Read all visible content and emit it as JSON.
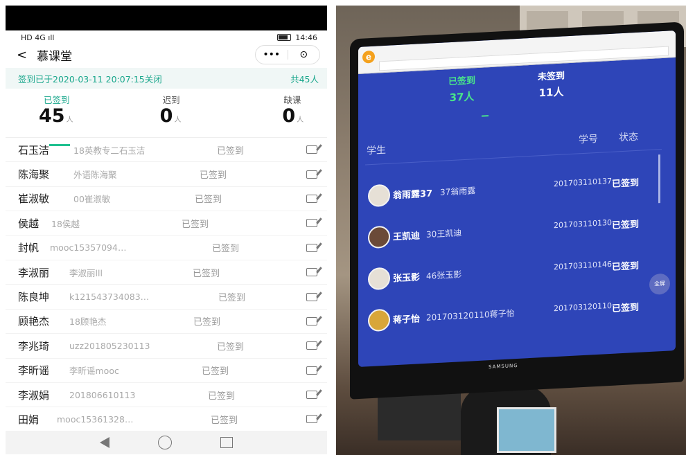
{
  "phone": {
    "status_bar": {
      "signal": "HD 4G ıll",
      "time": "14:46"
    },
    "nav": {
      "back_icon": "back-chevron-icon",
      "title": "慕课堂",
      "more_label": "•••",
      "close_icon": "record-circle-icon"
    },
    "notice": {
      "text": "签到已于2020-03-11 20:07:15关闭",
      "total": "共45人"
    },
    "stats": [
      {
        "label": "已签到",
        "value": "45",
        "unit": "人"
      },
      {
        "label": "迟到",
        "value": "0",
        "unit": "人"
      },
      {
        "label": "缺课",
        "value": "0",
        "unit": "人"
      }
    ],
    "students": [
      {
        "name": "石玉洁",
        "sub": "18英教专二石玉洁",
        "status": "已签到"
      },
      {
        "name": "陈海聚",
        "sub": "外语陈海聚",
        "status": "已签到"
      },
      {
        "name": "崔淑敏",
        "sub": "00崔淑敏",
        "status": "已签到"
      },
      {
        "name": "侯越",
        "sub": "18侯越",
        "status": "已签到"
      },
      {
        "name": "封帆",
        "sub": "mooc15357094…",
        "status": "已签到"
      },
      {
        "name": "李淑丽",
        "sub": "李淑丽lll",
        "status": "已签到"
      },
      {
        "name": "陈良坤",
        "sub": "k121543734083…",
        "status": "已签到"
      },
      {
        "name": "顾艳杰",
        "sub": "18顾艳杰",
        "status": "已签到"
      },
      {
        "name": "李兆琦",
        "sub": "uzz201805230113",
        "status": "已签到"
      },
      {
        "name": "李昕谣",
        "sub": "李昕谣mooc",
        "status": "已签到"
      },
      {
        "name": "李淑娟",
        "sub": "201806610113",
        "status": "已签到"
      },
      {
        "name": "田娟",
        "sub": "mooc15361328…",
        "status": "已签到"
      }
    ]
  },
  "monitor": {
    "tabs": [
      {
        "label": "已签到",
        "count": "37人"
      },
      {
        "label": "未签到",
        "count": "11人"
      }
    ],
    "headers": {
      "student": "学生",
      "id": "学号",
      "status": "状态"
    },
    "rows": [
      {
        "name": "翁雨露37",
        "desc": "37翁雨露",
        "id": "201703110137",
        "status": "已签到"
      },
      {
        "name": "王凯迪",
        "desc": "30王凯迪",
        "id": "201703110130",
        "status": "已签到"
      },
      {
        "name": "张玉影",
        "desc": "46张玉影",
        "id": "201703110146",
        "status": "已签到"
      },
      {
        "name": "蒋子怡",
        "desc": "201703120110蒋子怡",
        "id": "201703120110",
        "status": "已签到"
      }
    ],
    "fullscreen": "全屏",
    "brand": "SAMSUNG"
  }
}
